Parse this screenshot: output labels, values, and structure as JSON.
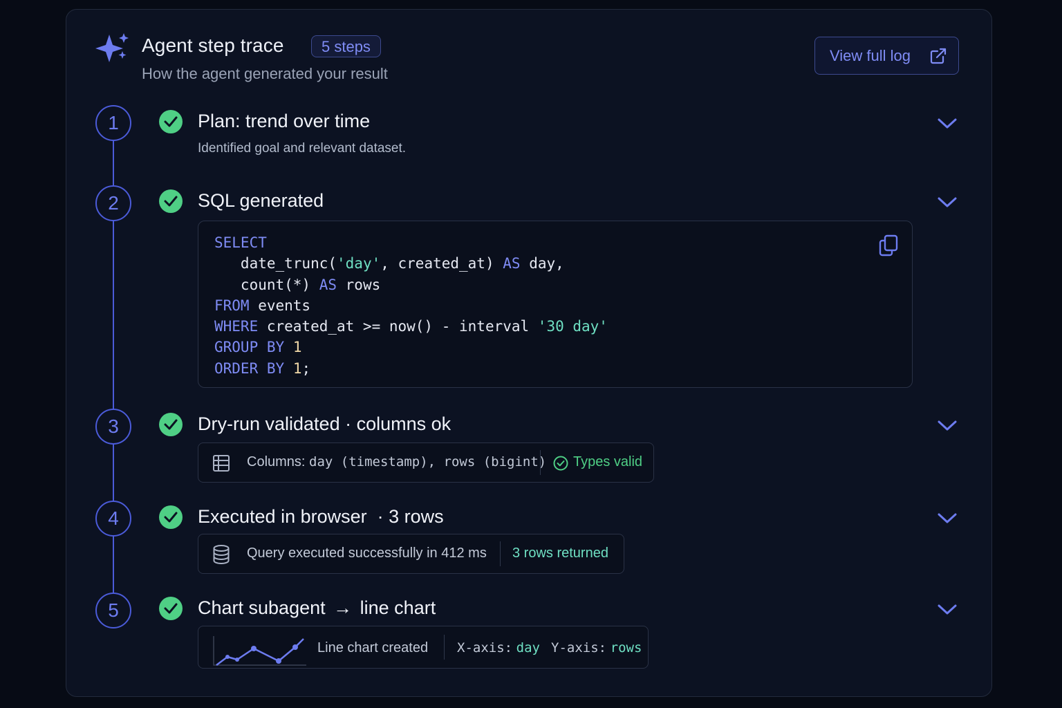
{
  "header": {
    "title": "Agent step trace",
    "badge": "5 steps",
    "subtitle": "How the agent generated your result",
    "view_log_label": "View full log"
  },
  "steps": [
    {
      "number": "1",
      "title": "Plan: trend over time",
      "description": "Identified goal and relevant dataset."
    },
    {
      "number": "2",
      "title": "SQL generated"
    },
    {
      "number": "3",
      "title": "Dry-run validated · columns ok"
    },
    {
      "number": "4",
      "title": "Executed in browser  · 3 rows"
    },
    {
      "number": "5",
      "title": "Chart subagent",
      "title_suffix": "line chart"
    }
  ],
  "sql": {
    "lines": [
      [
        {
          "t": "SELECT",
          "c": "kw"
        }
      ],
      [
        {
          "t": "   date_trunc("
        },
        {
          "t": "'day'",
          "c": "str"
        },
        {
          "t": ", created_at) "
        },
        {
          "t": "AS",
          "c": "kw"
        },
        {
          "t": " day,"
        }
      ],
      [
        {
          "t": "   count(*) "
        },
        {
          "t": "AS",
          "c": "kw"
        },
        {
          "t": " rows"
        }
      ],
      [
        {
          "t": "FROM",
          "c": "kw"
        },
        {
          "t": " events"
        }
      ],
      [
        {
          "t": "WHERE",
          "c": "kw"
        },
        {
          "t": " created_at >= now() - interval "
        },
        {
          "t": "'30 day'",
          "c": "str"
        }
      ],
      [
        {
          "t": "GROUP BY",
          "c": "kw"
        },
        {
          "t": " "
        },
        {
          "t": "1",
          "c": "num-lit"
        }
      ],
      [
        {
          "t": "ORDER BY",
          "c": "kw"
        },
        {
          "t": " "
        },
        {
          "t": "1",
          "c": "num-lit"
        },
        {
          "t": ";"
        }
      ]
    ]
  },
  "dryrun": {
    "columns_label": "Columns:",
    "columns_value": "day (timestamp), rows (bigint)",
    "status": "Types valid"
  },
  "execution": {
    "message": "Query executed successfully in 412 ms",
    "rows_returned": "3 rows returned"
  },
  "chart": {
    "created_label": "Line chart created",
    "x_label": "X-axis:",
    "x_value": "day",
    "y_label": "Y-axis:",
    "y_value": "rows"
  },
  "icons": {
    "header": "sparkle-icon",
    "step_status": "check-circle-icon",
    "expand": "chevron-down-icon",
    "copy": "copy-icon",
    "external": "external-link-icon",
    "table": "table-icon",
    "database": "database-icon",
    "chart": "line-chart-thumbnail"
  },
  "colors": {
    "background": "#070b15",
    "card": "#0c1222",
    "accent": "#7f8cf5",
    "timeline": "#4b5bd9",
    "success": "#4fcf85",
    "string": "#6fe0c3"
  }
}
